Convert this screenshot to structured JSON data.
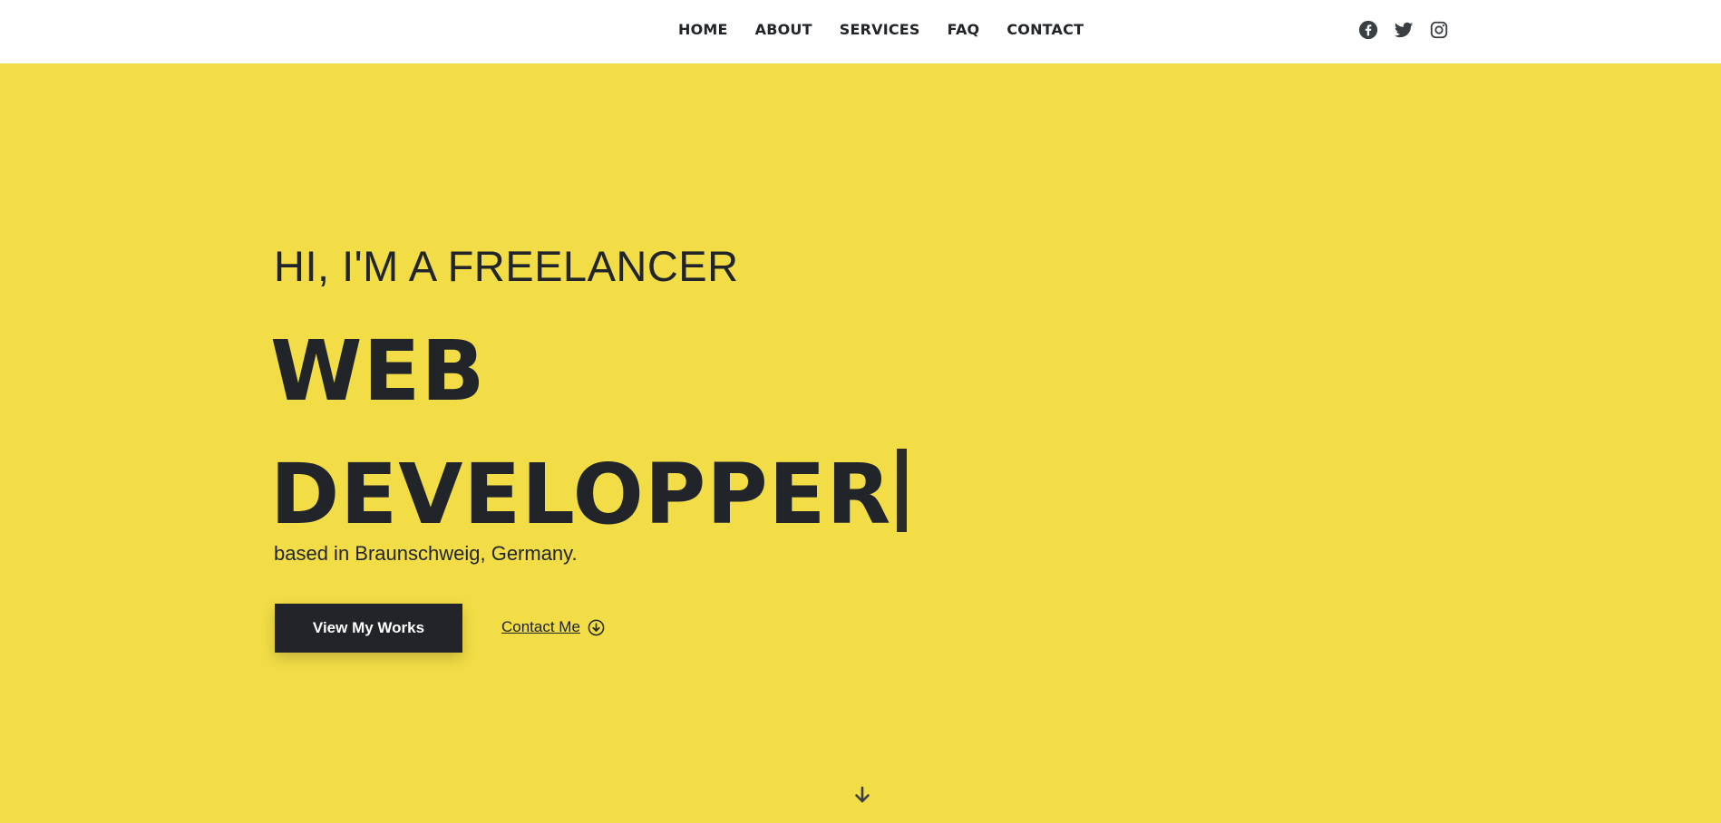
{
  "nav": {
    "items": [
      {
        "label": "HOME"
      },
      {
        "label": "ABOUT"
      },
      {
        "label": "SERVICES"
      },
      {
        "label": "FAQ"
      },
      {
        "label": "CONTACT"
      }
    ],
    "social": [
      {
        "icon": "facebook-icon"
      },
      {
        "icon": "twitter-icon"
      },
      {
        "icon": "instagram-icon"
      }
    ]
  },
  "hero": {
    "subtitle": "HI, I'M A FREELANCER",
    "title_line1": "WEB",
    "title_line2": "DEVELOPPER",
    "location": "based in Braunschweig, Germany.",
    "primary_button": "View My Works",
    "contact_link": "Contact Me"
  },
  "colors": {
    "hero_background": "#f2dd46",
    "text_dark": "#212529",
    "navbar_background": "#ffffff"
  }
}
